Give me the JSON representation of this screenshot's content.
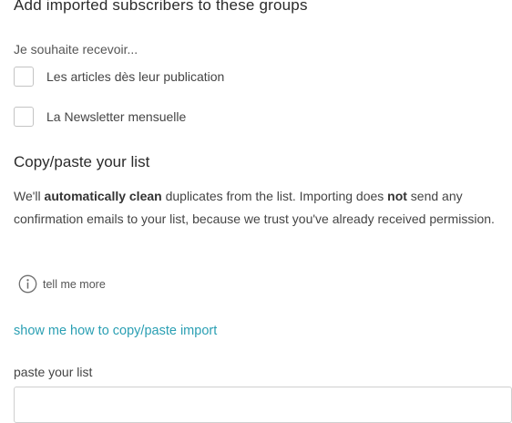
{
  "groups_section": {
    "title": "Add imported subscribers to these groups",
    "intro": "Je souhaite recevoir...",
    "options": [
      {
        "label": "Les articles dès leur publication",
        "checked": false
      },
      {
        "label": "La Newsletter mensuelle",
        "checked": false
      }
    ]
  },
  "copy_section": {
    "title": "Copy/paste your list",
    "desc": {
      "part1": "We'll ",
      "bold1": "automatically clean",
      "part2": " duplicates from the list. Importing does ",
      "bold2": "not",
      "part3": " send any confirmation emails to your list, because we trust you've already received permission."
    },
    "tell_more": {
      "icon": "info-icon",
      "label": "tell me more"
    },
    "howto_link": "show me how to copy/paste import",
    "paste_label": "paste your list",
    "paste_value": ""
  },
  "colors": {
    "link": "#2a9fb3",
    "text": "#444444",
    "heading": "#2b2b2b",
    "checkbox_border": "#c4c4c4"
  }
}
